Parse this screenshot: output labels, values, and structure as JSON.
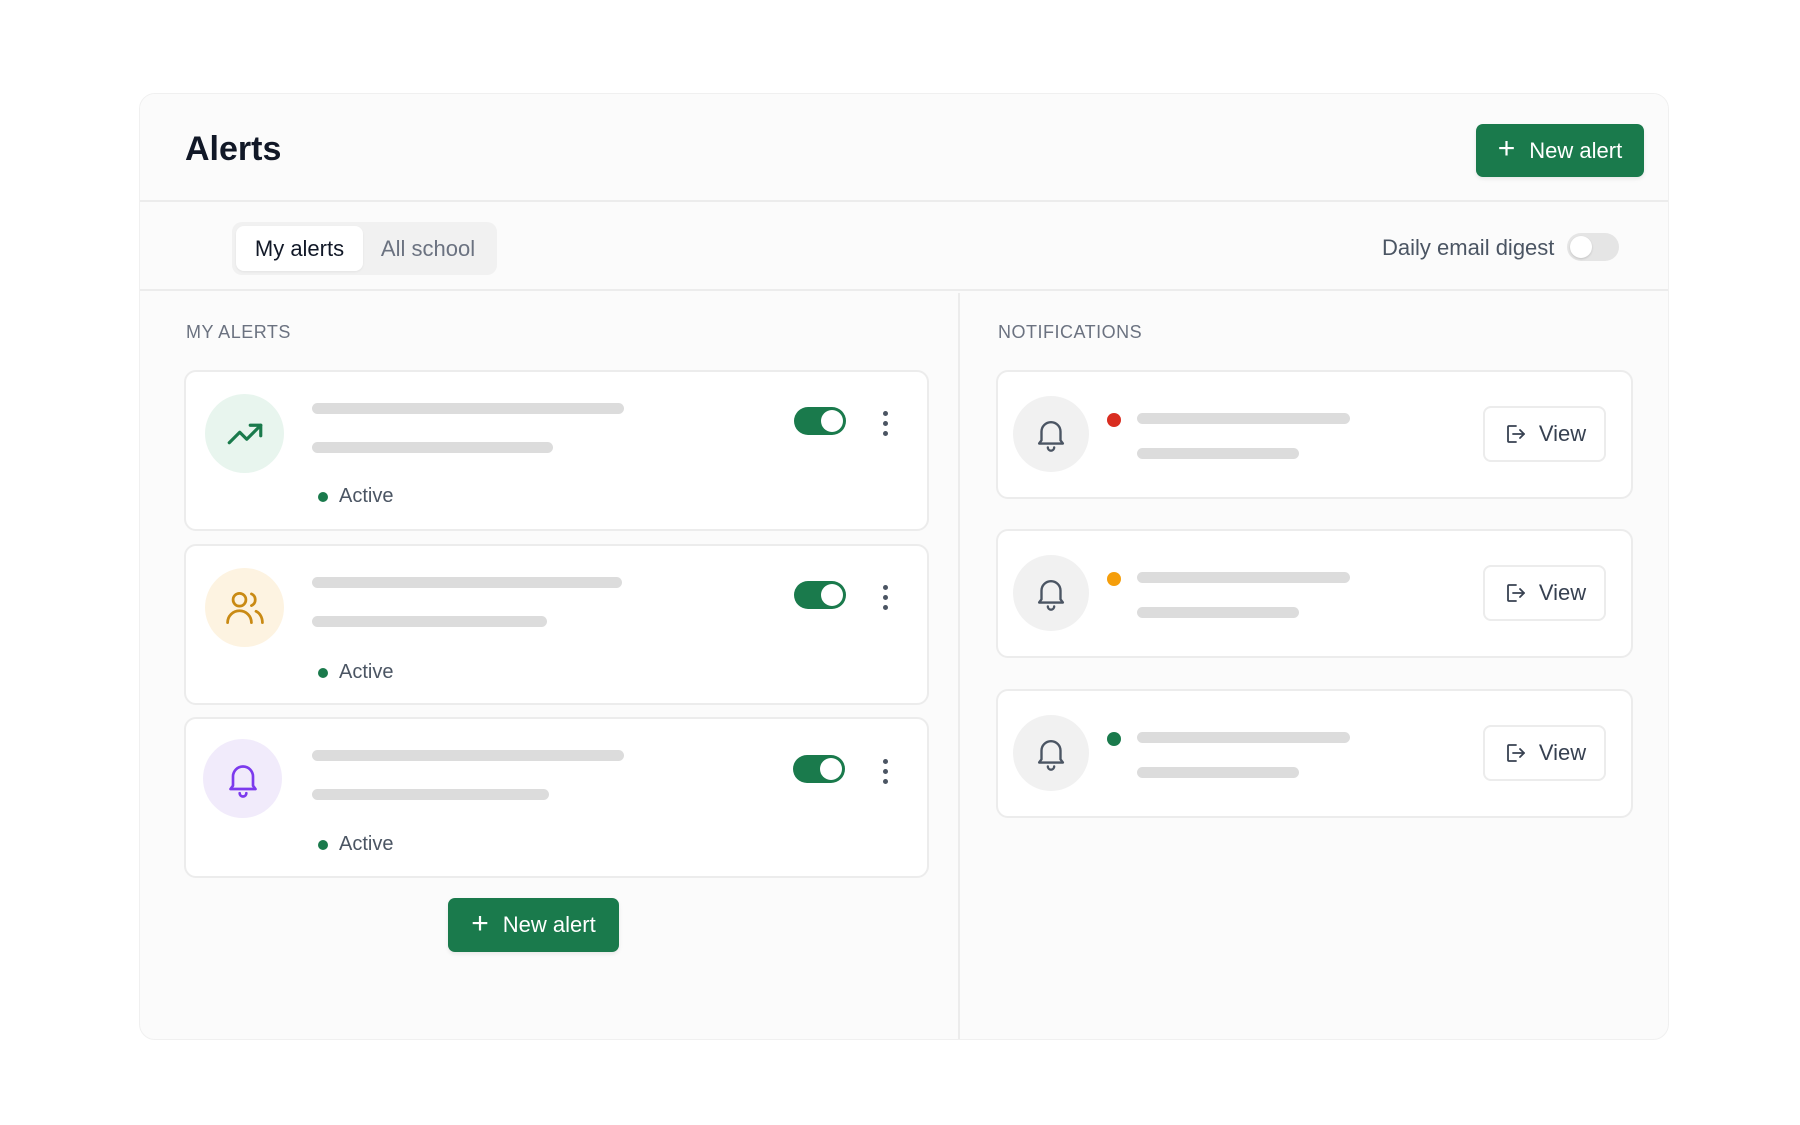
{
  "header": {
    "title": "Alerts",
    "new_alert_label": "New alert",
    "plus_symbol": "+"
  },
  "tabs": [
    {
      "label": "My alerts",
      "active": true
    },
    {
      "label": "All school",
      "active": false
    }
  ],
  "digest": {
    "label": "Daily email digest",
    "enabled": false
  },
  "my_alerts": {
    "section_label": "MY ALERTS",
    "items": [
      {
        "icon": "trending-up-icon",
        "icon_color": "#1a7a4c",
        "icon_bg": "#e8f5ee",
        "status": "Active",
        "enabled": true
      },
      {
        "icon": "users-icon",
        "icon_color": "#c98a14",
        "icon_bg": "#fdf3e1",
        "status": "Active",
        "enabled": true
      },
      {
        "icon": "bell-icon",
        "icon_color": "#7c3aed",
        "icon_bg": "#f1ebfb",
        "status": "Active",
        "enabled": true
      }
    ],
    "new_alert_label": "New alert"
  },
  "notifications": {
    "section_label": "NOTIFICATIONS",
    "items": [
      {
        "icon": "bell-icon",
        "dot_color": "#d92d20",
        "view_label": "View"
      },
      {
        "icon": "bell-icon",
        "dot_color": "#f59e0b",
        "view_label": "View"
      },
      {
        "icon": "bell-icon",
        "dot_color": "#1a7a4c",
        "view_label": "View"
      }
    ]
  },
  "colors": {
    "primary": "#1a7a4c",
    "border": "#ececec",
    "placeholder": "#dcdcdc"
  }
}
